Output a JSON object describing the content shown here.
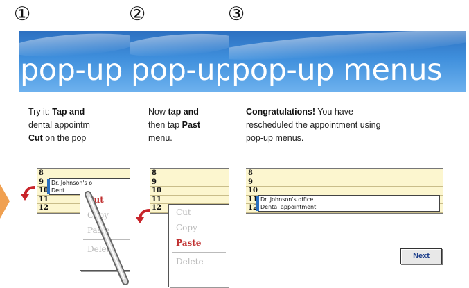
{
  "steps": {
    "step1_num": "①",
    "step2_num": "②",
    "step3_num": "③"
  },
  "panel1": {
    "title": "pop-up",
    "instr_line1_pre": "Try it: ",
    "instr_line1_bold": "Tap and",
    "instr_line2": "dental appointm",
    "instr_line3_bold": "Cut",
    "instr_line3_post": " on the pop",
    "hours": [
      "8",
      "9",
      "10",
      "11",
      "12"
    ],
    "appt_line1": "Dr. Johnson's o",
    "appt_line2": "Dent",
    "menu_items": [
      "Cut",
      "Copy",
      "Paste",
      "Delete"
    ]
  },
  "panel2": {
    "title": "pop-up",
    "instr_line1_pre": "Now ",
    "instr_line1_bold": "tap and",
    "instr_line2_pre": "then tap ",
    "instr_line2_bold": "Past",
    "instr_line3": "menu.",
    "hours": [
      "8",
      "9",
      "10",
      "11",
      "12"
    ],
    "menu_items": [
      "Cut",
      "Copy",
      "Paste",
      "Delete"
    ]
  },
  "panel3": {
    "title": "pop-up menus",
    "instr_line1_bold": "Congratulations!",
    "instr_line1_post": " You have",
    "instr_line2": "rescheduled the appointment using",
    "instr_line3": "pop-up menus.",
    "hours": [
      "8",
      "9",
      "10",
      "11",
      "12"
    ],
    "appt_line1": "Dr. Johnson's office",
    "appt_line2": "Dental appointment",
    "next_label": "Next"
  },
  "colors": {
    "banner": "#3f8fdc",
    "calendar_bg": "#fcf6cf",
    "menu_active": "#c03030",
    "arrow": "#c8242a",
    "next_text": "#1a3c8a"
  }
}
